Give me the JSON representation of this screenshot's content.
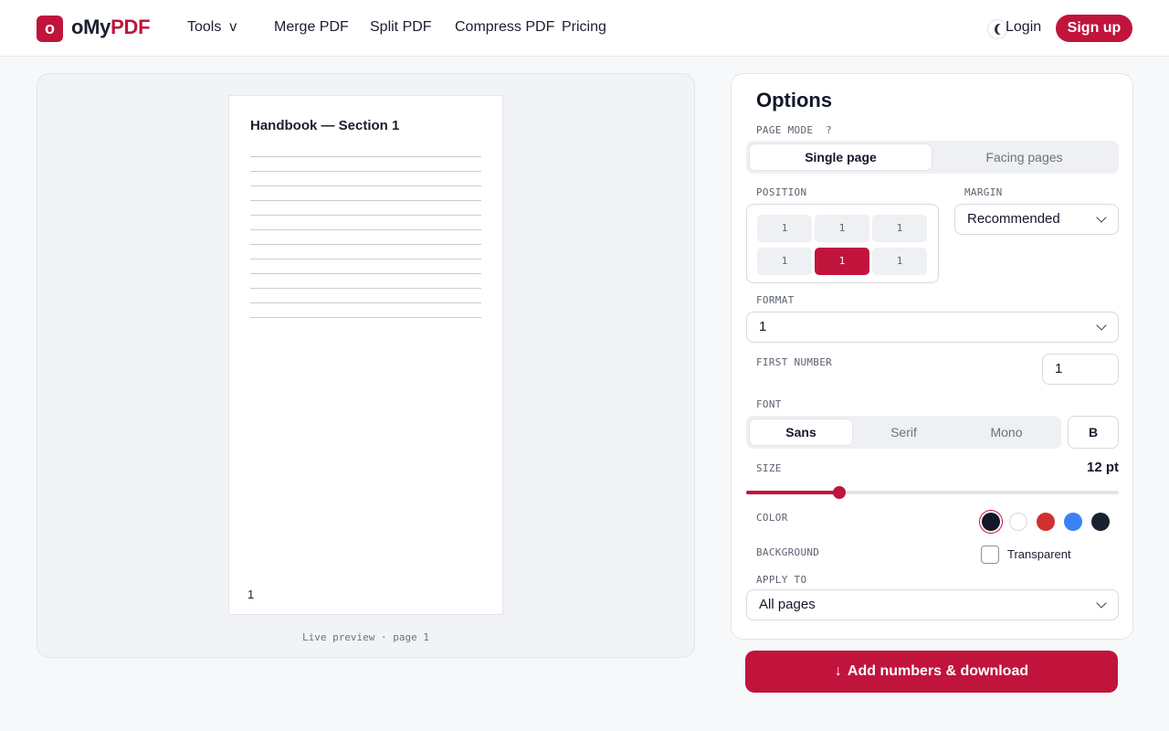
{
  "header": {
    "logo_letter": "o",
    "logo_prefix": "oMy",
    "logo_suffix": "PDF",
    "nav": [
      "Tools  v",
      "Merge PDF",
      "Split PDF",
      "Compress PDF",
      "Pricing"
    ],
    "login": "Login",
    "signup": "Sign up"
  },
  "preview": {
    "doc_title": "Handbook — Section 1",
    "page_number": "1",
    "caption": "Live preview · page 1"
  },
  "options": {
    "title": "Options",
    "page_mode_label": "PAGE MODE  ?",
    "page_modes": [
      "Single page",
      "Facing pages"
    ],
    "position_label": "POSITION",
    "position_cells": [
      "1",
      "1",
      "1",
      "1",
      "1",
      "1"
    ],
    "margin_label": "MARGIN",
    "margin_value": "Recommended",
    "format_label": "FORMAT",
    "format_value": "1",
    "first_number_label": "FIRST NUMBER",
    "first_number_value": "1",
    "font_label": "FONT",
    "fonts": [
      "Sans",
      "Serif",
      "Mono"
    ],
    "bold_label": "B",
    "size_label": "SIZE",
    "size_value": "12 pt",
    "size_fraction": 0.25,
    "color_label": "COLOR",
    "colors": [
      "#12172a",
      "#ffffff",
      "#d0302f",
      "#3b82f6",
      "#1a2130"
    ],
    "background_label": "BACKGROUND",
    "transparent_label": "Transparent",
    "apply_to_label": "APPLY TO",
    "apply_to_value": "All pages"
  },
  "cta": {
    "label": "Add numbers & download"
  },
  "colors": {
    "accent": "#c0143c"
  }
}
